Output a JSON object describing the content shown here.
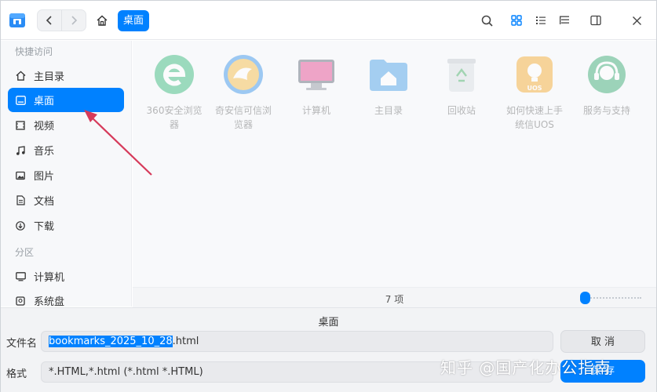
{
  "titlebar": {
    "crumb_active": "桌面",
    "icons": [
      "app-logo",
      "back-arrow",
      "forward-arrow",
      "home-icon",
      "search-icon",
      "icon-view-icon",
      "list-view-icon",
      "tree-view-icon",
      "sidebar-toggle-icon",
      "close-icon"
    ]
  },
  "sidebar": {
    "group_quick": "快捷访问",
    "group_partition": "分区",
    "items": [
      {
        "label": "主目录",
        "icon": "home-icon"
      },
      {
        "label": "桌面",
        "icon": "desktop-icon",
        "active": true
      },
      {
        "label": "视频",
        "icon": "video-icon"
      },
      {
        "label": "音乐",
        "icon": "music-icon"
      },
      {
        "label": "图片",
        "icon": "picture-icon"
      },
      {
        "label": "文档",
        "icon": "document-icon"
      },
      {
        "label": "下载",
        "icon": "download-icon"
      },
      {
        "label": "计算机",
        "icon": "computer-icon"
      },
      {
        "label": "系统盘",
        "icon": "disk-icon"
      }
    ]
  },
  "content": {
    "files": [
      {
        "line1": "360安全浏览",
        "line2": "器"
      },
      {
        "line1": "奇安信可信浏",
        "line2": "览器"
      },
      {
        "line1": "计算机",
        "line2": ""
      },
      {
        "line1": "主目录",
        "line2": ""
      },
      {
        "line1": "回收站",
        "line2": ""
      },
      {
        "line1": "如何快速上手",
        "line2": "统信UOS"
      },
      {
        "line1": "服务与支持",
        "line2": ""
      }
    ]
  },
  "status": {
    "item_count": "7 项",
    "zoom_level": 0.05
  },
  "bottom": {
    "destination": "桌面",
    "filename_label": "文件名",
    "filename_selected": "bookmarks_2025_10_28",
    "filename_ext": ".html",
    "format_label": "格式",
    "format_value": "*.HTML,*.html (*.html *.HTML)",
    "cancel_label": "取 消",
    "save_label": "保 存"
  },
  "watermark": "知乎 @国产化办公指南",
  "colors": {
    "accent": "#0081ff",
    "annotation": "#d63a5a"
  }
}
